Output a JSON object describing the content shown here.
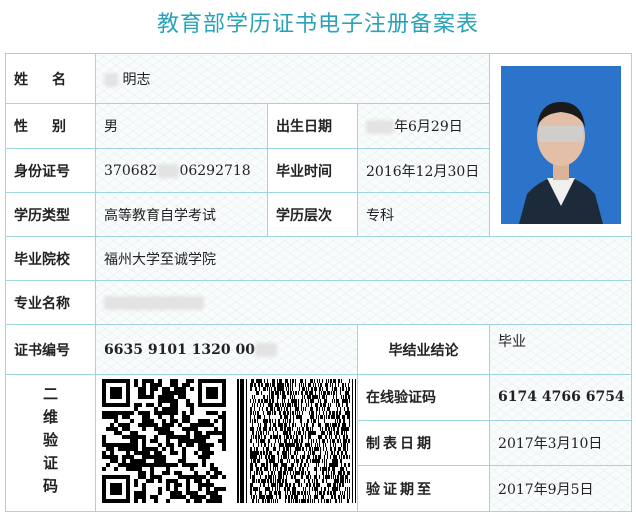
{
  "title": "教育部学历证书电子注册备案表",
  "labels": {
    "name": "姓名",
    "gender": "性别",
    "birth": "出生日期",
    "id": "身份证号",
    "grad_time": "毕业时间",
    "edu_type": "学历类型",
    "edu_level": "学历层次",
    "school": "毕业院校",
    "major": "专业名称",
    "cert_no": "证书编号",
    "conclusion": "毕结业结论",
    "qr": "二维验证码",
    "online_code": "在线验证码",
    "made_date": "制表日期",
    "valid_until": "验证期至"
  },
  "values": {
    "name_visible": "明志",
    "gender": "男",
    "birth_visible": "年6月29日",
    "id_prefix": "370682",
    "id_suffix": "06292718",
    "grad_time": "2016年12月30日",
    "edu_type": "高等教育自学考试",
    "edu_level": "专科",
    "school": "福州大学至诚学院",
    "cert_no_visible": "6635 9101 1320 00",
    "conclusion": "毕业",
    "online_code": "6174 4766 6754",
    "made_date": "2017年3月10日",
    "valid_until": "2017年9月5日"
  }
}
